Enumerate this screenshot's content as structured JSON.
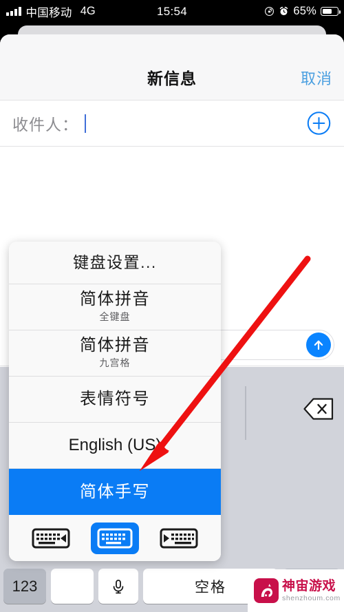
{
  "status_bar": {
    "carrier": "中国移动",
    "network": "4G",
    "time": "15:54",
    "battery_percent": "65%",
    "battery_level": 65,
    "icons": {
      "signal": "signal-bars-icon",
      "rotation_lock": "rotation-lock-icon",
      "alarm": "alarm-clock-icon",
      "battery": "battery-icon"
    }
  },
  "nav": {
    "title": "新信息",
    "cancel_label": "取消"
  },
  "recipient": {
    "label": "收件人：",
    "value": "",
    "placeholder": "",
    "add_contact_icon": "add-circle-icon"
  },
  "compose": {
    "placeholder": "",
    "value": "",
    "send_icon": "send-arrow-up-icon"
  },
  "keyboard_popup": {
    "items": [
      {
        "title": "键盘设置...",
        "subtitle": "",
        "selected": false,
        "kind": "settings"
      },
      {
        "title": "简体拼音",
        "subtitle": "全键盘",
        "selected": false,
        "kind": "two-line"
      },
      {
        "title": "简体拼音",
        "subtitle": "九宫格",
        "selected": false,
        "kind": "two-line"
      },
      {
        "title": "表情符号",
        "subtitle": "",
        "selected": false,
        "kind": "one-line"
      },
      {
        "title": "English (US)",
        "subtitle": "",
        "selected": false,
        "kind": "one-line"
      },
      {
        "title": "简体手写",
        "subtitle": "",
        "selected": true,
        "kind": "one-line"
      }
    ],
    "layout_buttons": [
      {
        "icon": "keyboard-dock-left-icon",
        "active": false
      },
      {
        "icon": "keyboard-full-icon",
        "active": true
      },
      {
        "icon": "keyboard-dock-right-icon",
        "active": false
      }
    ],
    "highlight_color": "#0a7cf5"
  },
  "keyboard": {
    "delete_icon": "backspace-delete-icon",
    "keys": {
      "numeric": "123",
      "mic_icon": "microphone-icon",
      "space": "空格",
      "return_label": ""
    }
  },
  "annotation": {
    "arrow_color": "#ee1111",
    "points_to": "简体手写"
  },
  "watermark": {
    "brand_cn": "神宙游戏",
    "brand_url": "shenzhoum.com",
    "logo_icon": "unicorn-logo-icon",
    "color": "#c8104a"
  }
}
